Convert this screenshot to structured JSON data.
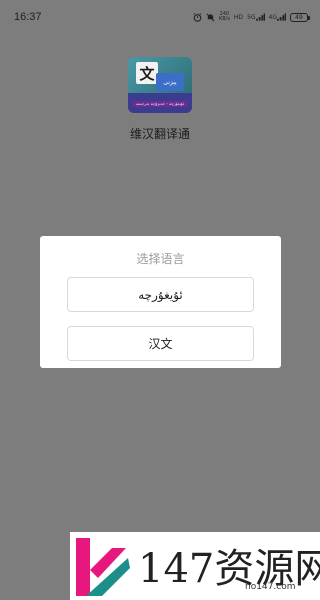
{
  "status_bar": {
    "time": "16:37",
    "net_speed_top": "240",
    "net_speed_bottom": "KB/s",
    "hd_label": "HD",
    "net_5g": "5G",
    "net_4g": "4G",
    "battery": "49"
  },
  "app": {
    "icon_main_char": "文",
    "icon_secondary_text": "بېزنى",
    "icon_strip_text": "ئۇيغۇرچە - خەنزۇچە تەرجىمە",
    "name": "维汉翻译通"
  },
  "dialog": {
    "title": "选择语言",
    "options": [
      {
        "label": "ئۇيغۇرچە"
      },
      {
        "label": "汉文"
      }
    ]
  },
  "watermark": {
    "text": "147资源网",
    "url": "no147.com"
  },
  "colors": {
    "overlay": "#7d7d7d",
    "dialog_bg": "#ffffff",
    "button_border": "#d9d9d9",
    "title_text": "#9a9a9a",
    "logo_pink": "#e8177e",
    "logo_teal": "#1d8f8a"
  }
}
